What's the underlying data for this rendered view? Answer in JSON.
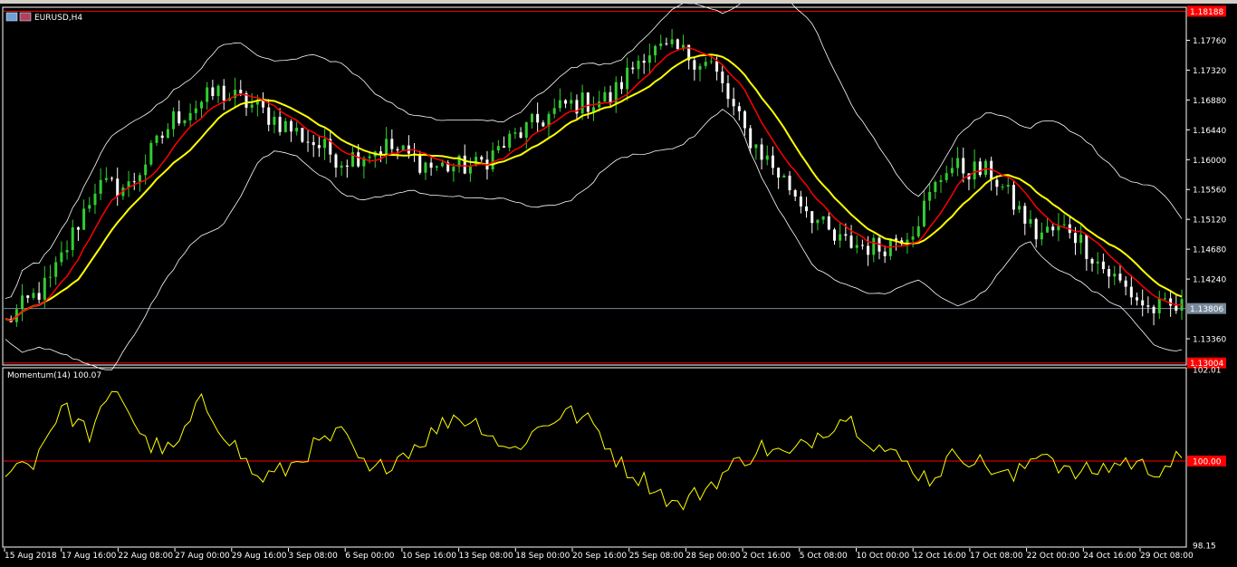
{
  "window": {
    "title": "EURUSD,H4"
  },
  "colors": {
    "background": "#000000",
    "candle_bull": "#32cd32",
    "candle_bear": "#ffffff",
    "ma_fast": "#ff0000",
    "ma_slow": "#ffff00",
    "bollinger": "#ffffff",
    "momentum": "#ffff00",
    "level_line": "#ff0000",
    "price_line": "#778899",
    "axis": "#ffffff"
  },
  "chart_data": [
    {
      "type": "candlestick",
      "title": "EURUSD,H4",
      "symbol": "EURUSD",
      "timeframe": "H4",
      "ylim": [
        1.13,
        1.1822
      ],
      "y_ticks": [
        "1.17760",
        "1.17320",
        "1.16880",
        "1.16440",
        "1.16000",
        "1.15560",
        "1.15120",
        "1.14680",
        "1.14240",
        "1.13360"
      ],
      "price_tags": [
        {
          "label": "1.18188",
          "value": 1.18188,
          "color": "#ff0000",
          "text_color": "#ffffff"
        },
        {
          "label": "1.13806",
          "value": 1.13806,
          "color": "#778899",
          "text_color": "#ffffff"
        },
        {
          "label": "1.13004",
          "value": 1.13004,
          "color": "#ff0000",
          "text_color": "#ffffff"
        }
      ],
      "x_ticks": [
        "15 Aug 2018",
        "17 Aug 16:00",
        "22 Aug 08:00",
        "27 Aug 00:00",
        "29 Aug 16:00",
        "3 Sep 08:00",
        "6 Sep 00:00",
        "10 Sep 16:00",
        "13 Sep 08:00",
        "18 Sep 00:00",
        "20 Sep 16:00",
        "25 Sep 08:00",
        "28 Sep 00:00",
        "2 Oct 16:00",
        "5 Oct 08:00",
        "10 Oct 00:00",
        "12 Oct 16:00",
        "17 Oct 08:00",
        "22 Oct 00:00",
        "24 Oct 16:00",
        "29 Oct 08:00"
      ],
      "close_path": [
        [
          0,
          1.136
        ],
        [
          8,
          1.142
        ],
        [
          16,
          1.156
        ],
        [
          22,
          1.156
        ],
        [
          30,
          1.166
        ],
        [
          38,
          1.17
        ],
        [
          44,
          1.168
        ],
        [
          52,
          1.164
        ],
        [
          60,
          1.16
        ],
        [
          68,
          1.162
        ],
        [
          76,
          1.159
        ],
        [
          84,
          1.159
        ],
        [
          92,
          1.164
        ],
        [
          100,
          1.168
        ],
        [
          108,
          1.169
        ],
        [
          114,
          1.176
        ],
        [
          120,
          1.176
        ],
        [
          126,
          1.174
        ],
        [
          132,
          1.164
        ],
        [
          140,
          1.156
        ],
        [
          148,
          1.148
        ],
        [
          156,
          1.147
        ],
        [
          162,
          1.15
        ],
        [
          168,
          1.159
        ],
        [
          176,
          1.158
        ],
        [
          184,
          1.149
        ],
        [
          190,
          1.15
        ],
        [
          196,
          1.144
        ],
        [
          204,
          1.138
        ],
        [
          210,
          1.1381
        ]
      ],
      "indicators": [
        {
          "name": "MA fast",
          "color": "#ff0000"
        },
        {
          "name": "MA slow",
          "color": "#ffff00"
        },
        {
          "name": "Bollinger Bands",
          "color": "#ffffff"
        }
      ]
    },
    {
      "type": "line",
      "title": "Momentum(14) 100.07",
      "series": [
        {
          "name": "Momentum(14)",
          "last": 100.07
        }
      ],
      "ylim": [
        98.15,
        102.01
      ],
      "y_ticks": [
        "102.01",
        "98.15"
      ],
      "level": {
        "label": "100.00",
        "value": 100.0
      },
      "path": [
        [
          0,
          99.85
        ],
        [
          5,
          100.0
        ],
        [
          10,
          101.2
        ],
        [
          15,
          100.6
        ],
        [
          20,
          101.6
        ],
        [
          25,
          100.4
        ],
        [
          30,
          100.2
        ],
        [
          35,
          101.3
        ],
        [
          40,
          100.5
        ],
        [
          45,
          99.6
        ],
        [
          50,
          99.8
        ],
        [
          55,
          100.3
        ],
        [
          60,
          100.6
        ],
        [
          65,
          99.7
        ],
        [
          70,
          100.1
        ],
        [
          75,
          100.5
        ],
        [
          80,
          101.0
        ],
        [
          85,
          100.8
        ],
        [
          90,
          100.2
        ],
        [
          95,
          100.7
        ],
        [
          100,
          101.1
        ],
        [
          105,
          100.8
        ],
        [
          110,
          99.9
        ],
        [
          115,
          99.5
        ],
        [
          120,
          99.0
        ],
        [
          125,
          99.4
        ],
        [
          130,
          99.9
        ],
        [
          135,
          100.3
        ],
        [
          140,
          100.1
        ],
        [
          145,
          100.6
        ],
        [
          150,
          101.0
        ],
        [
          155,
          100.4
        ],
        [
          160,
          100.0
        ],
        [
          165,
          99.6
        ],
        [
          170,
          100.2
        ],
        [
          175,
          99.9
        ],
        [
          180,
          99.6
        ],
        [
          185,
          100.3
        ],
        [
          190,
          99.7
        ],
        [
          195,
          99.8
        ],
        [
          200,
          100.0
        ],
        [
          205,
          99.8
        ],
        [
          210,
          100.07
        ]
      ]
    }
  ]
}
